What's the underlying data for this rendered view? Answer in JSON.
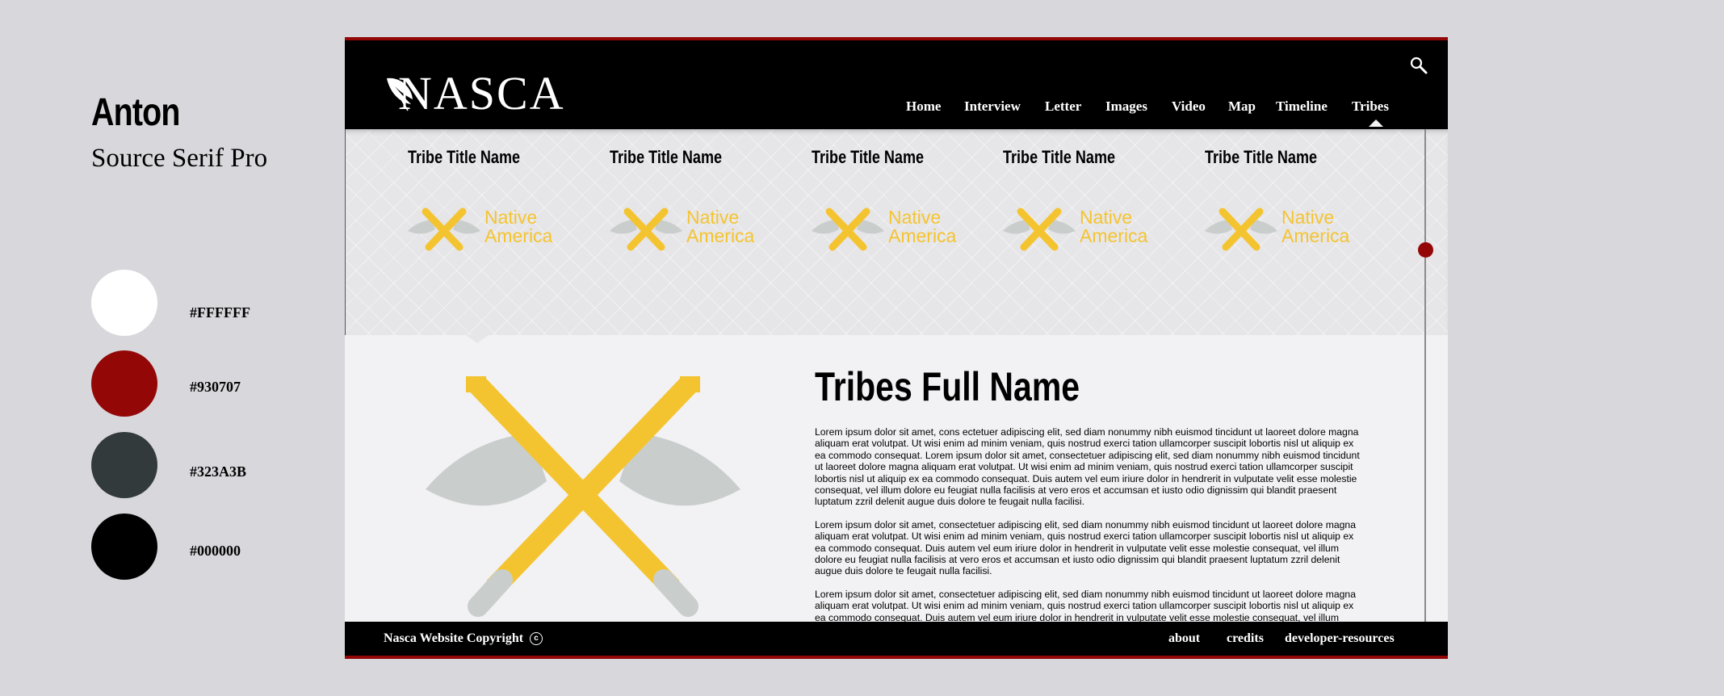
{
  "style_guide": {
    "fonts": [
      "Anton",
      "Source Serif Pro"
    ],
    "colors": [
      {
        "hex": "#FFFFFF",
        "label": "#FFFFFF"
      },
      {
        "hex": "#930707",
        "label": "#930707"
      },
      {
        "hex": "#323A3B",
        "label": "#323A3B"
      },
      {
        "hex": "#000000",
        "label": "#000000"
      }
    ]
  },
  "site": {
    "logo_text": "NASCA",
    "nav": [
      "Home",
      "Interview",
      "Letter",
      "Images",
      "Video",
      "Map",
      "Timeline",
      "Tribes"
    ],
    "tribes": [
      {
        "title": "Tribe Title Name",
        "logo_text": "Native\nAmerica"
      },
      {
        "title": "Tribe Title Name",
        "logo_text": "Native\nAmerica"
      },
      {
        "title": "Tribe Title Name",
        "logo_text": "Native\nAmerica"
      },
      {
        "title": "Tribe Title Name",
        "logo_text": "Native\nAmerica"
      },
      {
        "title": "Tribe Title Name",
        "logo_text": "Native\nAmerica"
      }
    ],
    "content_title": "Tribes Full Name",
    "paragraphs": [
      "Lorem ipsum dolor sit amet, cons ectetuer adipiscing elit, sed diam nonummy nibh euismod tincidunt ut laoreet dolore magna aliquam erat volutpat. Ut wisi enim ad minim veniam, quis nostrud exerci tation ullamcorper suscipit lobortis nisl ut aliquip ex ea commodo consequat. Lorem ipsum dolor sit amet, consectetuer adipiscing elit, sed diam nonummy nibh euismod tincidunt ut laoreet dolore magna aliquam erat volutpat. Ut wisi enim ad minim veniam, quis nostrud exerci tation ullamcorper suscipit lobortis nisl ut aliquip ex ea commodo consequat. Duis autem vel eum iriure dolor in hendrerit in vulputate velit esse molestie consequat, vel illum dolore eu feugiat nulla facilisis at vero eros et accumsan et iusto odio dignissim qui blandit praesent luptatum zzril delenit augue duis dolore te feugait nulla facilisi.",
      "Lorem ipsum dolor sit amet, consectetuer adipiscing elit, sed diam nonummy nibh euismod tincidunt ut laoreet dolore magna aliquam erat volutpat. Ut wisi enim ad minim veniam, quis nostrud exerci tation ullamcorper suscipit lobortis nisl ut aliquip ex ea commodo consequat. Duis autem vel eum iriure dolor in hendrerit in vulputate velit esse molestie consequat, vel illum dolore eu feugiat nulla facilisis at vero eros et accumsan et iusto odio dignissim qui blandit praesent luptatum zzril delenit augue duis dolore te feugait nulla facilisi.",
      "Lorem ipsum dolor sit amet, consectetuer adipiscing elit, sed diam nonummy nibh euismod tincidunt ut laoreet dolore magna aliquam erat volutpat. Ut wisi enim ad minim veniam, quis nostrud exerci tation ullamcorper suscipit lobortis nisl ut aliquip ex ea commodo consequat. Duis autem vel eum iriure dolor in hendrerit in vulputate velit esse molestie consequat, vel illum dolore eu feugiat nulla facili-"
    ],
    "footer": {
      "copyright": "Nasca Website Copyright",
      "copyright_symbol": "c",
      "links": [
        "about",
        "credits",
        "developer-resources"
      ]
    },
    "icons": {
      "search": "search-icon",
      "tribe_logo": "crossed-axes-icon",
      "copyright": "copyright-icon"
    },
    "accent_colors": {
      "brand_red": "#930707",
      "gold": "#F4C430",
      "steel": "#C9CECD"
    }
  }
}
